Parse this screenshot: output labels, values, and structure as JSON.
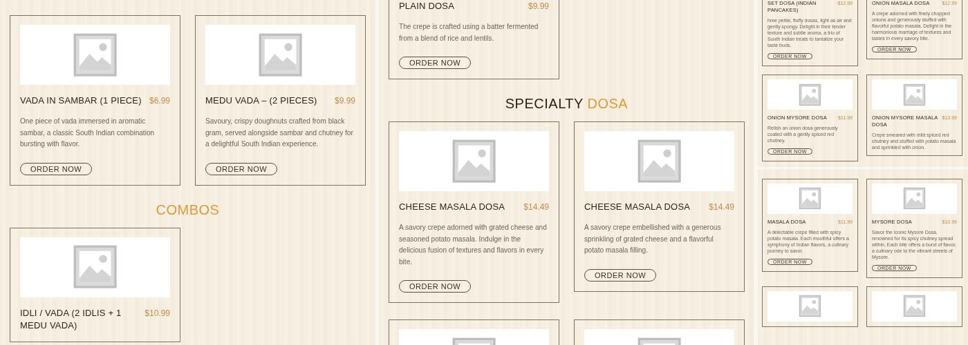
{
  "panels": [
    {
      "kind": "regular",
      "shots": [
        {
          "sections": [
            {
              "items": [
                {
                  "kind": "full",
                  "title": "VADA IN SAMBAR (1 PIECE)",
                  "price": "$6.99",
                  "description": "One piece of vada immersed in aromatic sambar, a classic South Indian combination bursting with flavor.",
                  "button": "ORDER NOW"
                },
                {
                  "kind": "full",
                  "title": "MEDU VADA – (2 PIECES)",
                  "price": "$9.99",
                  "description": "Savoury, crispy doughnuts crafted from black gram, served alongside sambar and chutney for a delightful South Indian experience.",
                  "button": "ORDER NOW"
                }
              ]
            },
            {
              "heading": [
                {
                  "text": "COMBOS",
                  "accent": true
                }
              ],
              "items": [
                {
                  "kind": "full",
                  "title": "IDLI / VADA (2 IDLIS + 1 MEDU VADA)",
                  "price": "$10.99"
                }
              ]
            }
          ]
        }
      ]
    },
    {
      "kind": "regular",
      "shots": [
        {
          "sections": [
            {
              "items": [
                {
                  "kind": "top-cut",
                  "title": "PLAIN DOSA",
                  "price": "$9.99",
                  "description": "The crepe is crafted using a batter fermented from a blend of rice and lentils.",
                  "button": "ORDER NOW"
                }
              ]
            },
            {
              "heading": [
                {
                  "text": "SPECIALTY ",
                  "accent": false
                },
                {
                  "text": "DOSA",
                  "accent": true
                }
              ],
              "items": [
                {
                  "kind": "full",
                  "title": "CHEESE MASALA DOSA",
                  "price": "$14.49",
                  "description": "A savory crepe adorned with grated cheese and seasoned potato masala. Indulge in the delicious fusion of textures and flavors in every bite.",
                  "button": "ORDER NOW"
                },
                {
                  "kind": "full",
                  "title": "CHEESE MASALA DOSA",
                  "price": "$14.49",
                  "description": "A savory crepe embellished with a generous sprinkling of grated cheese and a flavorful potato masala filling.",
                  "button": "ORDER NOW"
                },
                {
                  "kind": "image-only"
                },
                {
                  "kind": "image-only"
                }
              ]
            }
          ]
        }
      ]
    },
    {
      "kind": "mini",
      "shots": [
        {
          "sections": [
            {
              "items": [
                {
                  "kind": "top-cut",
                  "title": "SET DOSA (INDIAN PANCAKES)",
                  "price": "$12.99",
                  "description": "hree petite, fluffy dosas, light as air and gently spongy. Delight in their tender texture and subtle aroma, a trio of South Indian treats to tantalize your taste buds.",
                  "button": "ORDER NOW"
                },
                {
                  "kind": "top-cut",
                  "title": "ONION MASALA DOSA",
                  "price": "$12.99",
                  "description": "A crepe adorned with finely chopped onions and generously stuffed with flavorful potato masala. Delight in the harmonious marriage of textures and tastes in every savory bite.",
                  "button": "ORDER NOW"
                },
                {
                  "kind": "full",
                  "title": "ONION MYSORE DOSA",
                  "price": "$11.99",
                  "description": "Relish an onion dosa generously coated with a gently spiced red chutney.",
                  "button": "ORDER NOW"
                },
                {
                  "kind": "full",
                  "title": "ONION MYSORE MASALA DOSA",
                  "price": "$13.99",
                  "description": "Crepe smeared with mild spiced red chutney and stuffed with potato masala and sprinkled with onion."
                }
              ]
            }
          ]
        },
        {
          "sections": [
            {
              "items": [
                {
                  "kind": "full",
                  "title": "MASALA DOSA",
                  "price": "$11.99",
                  "description": "A delectable crepe filled with spicy potato masala. Each mouthful offers a symphony of Indian flavors, a culinary journey to savor.",
                  "button": "ORDER NOW"
                },
                {
                  "kind": "full",
                  "title": "MYSORE DOSA",
                  "price": "$10.99",
                  "description": "Savor the iconic Mysore Dosa, renowned for its spicy chutney spread within. Each bite offers a burst of flavor, a culinary ode to the vibrant streets of Mysore.",
                  "button": "ORDER NOW"
                },
                {
                  "kind": "image-only"
                },
                {
                  "kind": "image-only"
                }
              ]
            }
          ]
        }
      ]
    }
  ]
}
